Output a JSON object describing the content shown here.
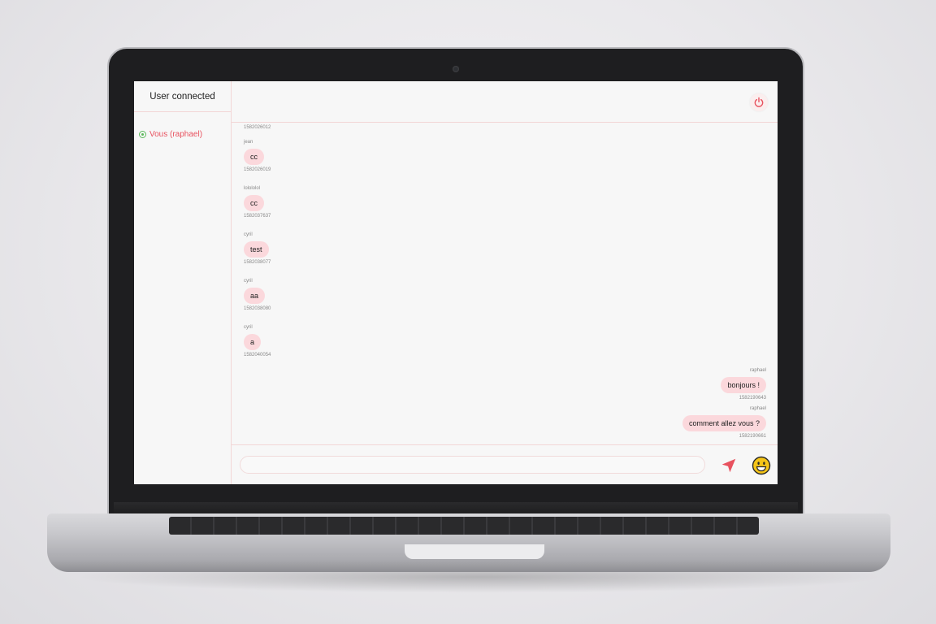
{
  "sidebar": {
    "title": "User connected",
    "users": [
      {
        "label": "Vous (raphael)",
        "status": "online"
      }
    ]
  },
  "topbar": {
    "logout_icon": "power-icon"
  },
  "messages": {
    "top_partial_stamp": "1582026012",
    "left": [
      {
        "sender": "jean",
        "text": "cc",
        "stamp": "1582026019"
      },
      {
        "sender": "lolololol",
        "text": "cc",
        "stamp": "1582037637"
      },
      {
        "sender": "cyril",
        "text": "test",
        "stamp": "1582038077"
      },
      {
        "sender": "cyril",
        "text": "aa",
        "stamp": "1582038080"
      },
      {
        "sender": "cyril",
        "text": "a",
        "stamp": "1582040054"
      }
    ],
    "right": [
      {
        "sender": "raphael",
        "text": "bonjours !",
        "stamp": "1582190643"
      },
      {
        "sender": "raphael",
        "text": "comment allez vous ?",
        "stamp": "1582190661"
      }
    ]
  },
  "composer": {
    "input_value": "",
    "input_placeholder": "",
    "send_icon": "send-arrow-icon",
    "emoji_icon": "emoji-icon"
  },
  "colors": {
    "accent": "#e8525f",
    "bubble": "#fbd8dc",
    "online": "#5cb85c",
    "divider": "#f2d6d6"
  }
}
